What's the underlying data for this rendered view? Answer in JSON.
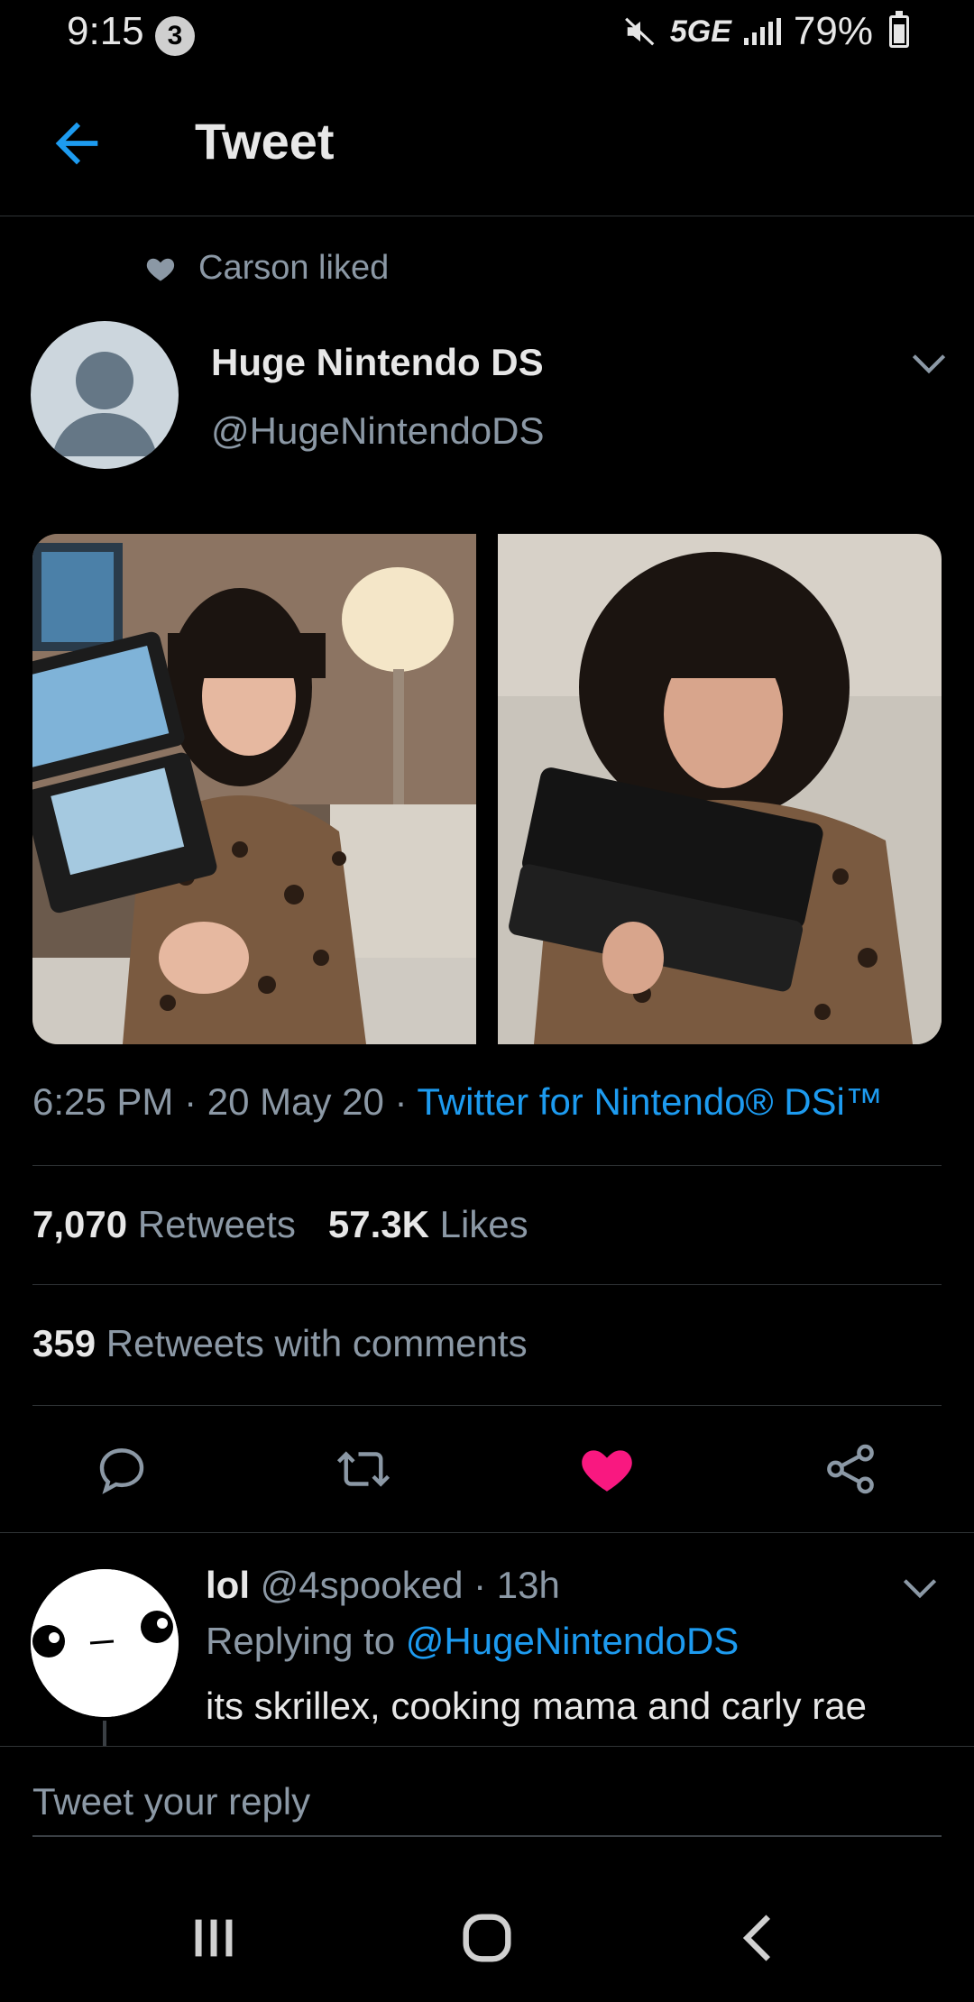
{
  "status_bar": {
    "time": "9:15",
    "notification_count": "3",
    "network": "5GE",
    "battery": "79%"
  },
  "header": {
    "title": "Tweet"
  },
  "tweet": {
    "social_context": "Carson liked",
    "author_name": "Huge Nintendo DS",
    "author_handle": "@HugeNintendoDS",
    "timestamp": "6:25 PM · 20 May 20 · ",
    "source": "Twitter for Nintendo® DSi™",
    "retweets_count": "7,070",
    "retweets_label": "Retweets",
    "likes_count": "57.3K",
    "likes_label": "Likes",
    "quote_count": "359",
    "quote_label": "Retweets with comments",
    "liked": true
  },
  "reply": {
    "name": "lol",
    "meta": " @4spooked · 13h",
    "replying_prefix": "Replying to ",
    "replying_to": "@HugeNintendoDS",
    "text": "its skrillex, cooking mama and carly rae jepsen in the same picture"
  },
  "compose": {
    "placeholder": "Tweet your reply"
  },
  "colors": {
    "accent": "#1d9bf0",
    "like": "#f91880",
    "background": "#000000",
    "secondary_text": "#8b98a5"
  },
  "icons": [
    "back-arrow-icon",
    "heart-icon",
    "chevron-down-icon",
    "reply-icon",
    "retweet-icon",
    "like-icon",
    "share-icon",
    "recents-icon",
    "home-icon",
    "back-icon"
  ]
}
